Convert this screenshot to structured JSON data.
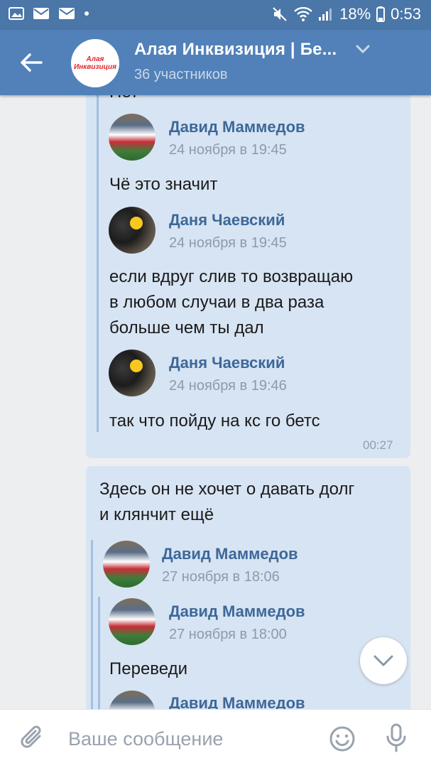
{
  "status_bar": {
    "battery": "18%",
    "time": "0:53"
  },
  "header": {
    "title": "Алая Инквизиция | Бе...",
    "subtitle": "36 участников",
    "avatar_text": [
      "Алая",
      "Инквизиция"
    ]
  },
  "messages": [
    {
      "cut_text": "Нет",
      "forwards": [
        {
          "name": "Давид Маммедов",
          "date": "24 ноября в 19:45",
          "lines": [
            "Чё это значит"
          ]
        },
        {
          "name": "Даня Чаевский",
          "date": "24 ноября в 19:45",
          "lines": [
            "если вдруг слив то возвращаю",
            "в любом случаи в два раза",
            "больше чем ты дал"
          ]
        },
        {
          "name": "Даня Чаевский",
          "date": "24 ноября в 19:46",
          "lines": [
            "так что пойду на кс го бетс"
          ]
        }
      ],
      "time": "00:27"
    },
    {
      "lines": [
        "Здесь он не хочет о давать долг",
        "и клянчит ещё"
      ],
      "forwards": [
        {
          "name": "Давид Маммедов",
          "date": "27 ноября в 18:06"
        },
        {
          "name": "Давид Маммедов",
          "date": "27 ноября в 18:00",
          "lines": [
            "Переведи"
          ]
        },
        {
          "name": "Давид Маммедов"
        }
      ]
    }
  ],
  "composer": {
    "placeholder": "Ваше сообщение"
  },
  "colors": {
    "header": "#5181b8",
    "status_bar": "#4a76a8",
    "bubble": "#d7e4f3",
    "name": "#3d6899"
  }
}
